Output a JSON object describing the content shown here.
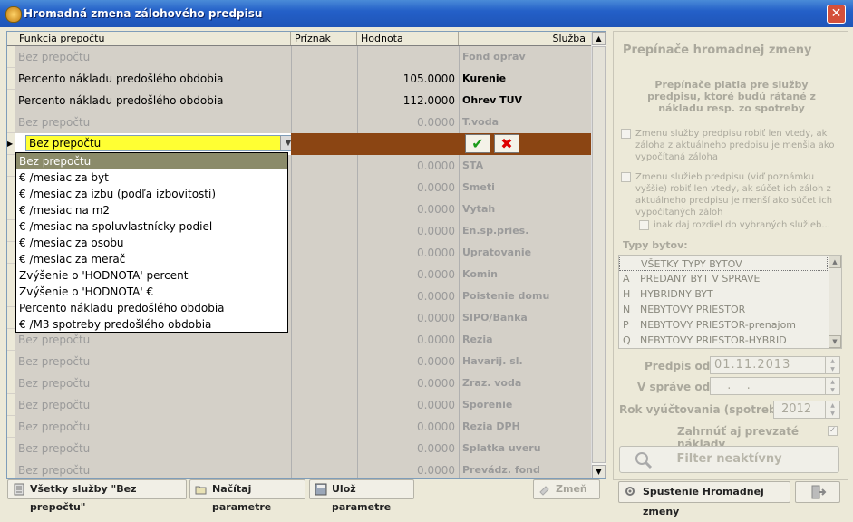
{
  "window": {
    "title": "Hromadná zmena zálohového predpisu",
    "close_glyph": "✕"
  },
  "grid": {
    "headers": [
      "Funkcia prepočtu",
      "Príznak",
      "Hodnota",
      "Služba"
    ],
    "rows": [
      {
        "func": "Bez prepočtu",
        "value": "",
        "service": "Fond oprav",
        "state": "inactive"
      },
      {
        "func": "Percento nákladu predošlého obdobia",
        "value": "105.0000",
        "service": "Kurenie",
        "state": "active"
      },
      {
        "func": "Percento nákladu predošlého obdobia",
        "value": "112.0000",
        "service": "Ohrev TUV",
        "state": "active"
      },
      {
        "func": "Bez prepočtu",
        "value": "0.0000",
        "service": "T.voda",
        "state": "inactive"
      },
      {
        "func": "Bez prepočtu",
        "value": "",
        "service": "",
        "state": "edit"
      },
      {
        "func": "",
        "value": "0.0000",
        "service": "STA",
        "state": "inactive"
      },
      {
        "func": "",
        "value": "0.0000",
        "service": "Smeti",
        "state": "inactive"
      },
      {
        "func": "",
        "value": "0.0000",
        "service": "Vytah",
        "state": "inactive"
      },
      {
        "func": "",
        "value": "0.0000",
        "service": "En.sp.pries.",
        "state": "inactive"
      },
      {
        "func": "",
        "value": "0.0000",
        "service": "Upratovanie",
        "state": "inactive"
      },
      {
        "func": "",
        "value": "0.0000",
        "service": "Komin",
        "state": "inactive"
      },
      {
        "func": "",
        "value": "0.0000",
        "service": "Poistenie domu",
        "state": "inactive"
      },
      {
        "func": "",
        "value": "0.0000",
        "service": "SIPO/Banka",
        "state": "inactive"
      },
      {
        "func": "Bez prepočtu",
        "value": "0.0000",
        "service": "Rezia",
        "state": "inactive"
      },
      {
        "func": "Bez prepočtu",
        "value": "0.0000",
        "service": "Havarij. sl.",
        "state": "inactive"
      },
      {
        "func": "Bez prepočtu",
        "value": "0.0000",
        "service": "Zraz. voda",
        "state": "inactive"
      },
      {
        "func": "Bez prepočtu",
        "value": "0.0000",
        "service": "Sporenie",
        "state": "inactive"
      },
      {
        "func": "Bez prepočtu",
        "value": "0.0000",
        "service": "Rezia DPH",
        "state": "inactive"
      },
      {
        "func": "Bez prepočtu",
        "value": "0.0000",
        "service": "Splatka uveru",
        "state": "inactive"
      },
      {
        "func": "Bez prepočtu",
        "value": "0.0000",
        "service": "Prevádz. fond",
        "state": "inactive"
      }
    ]
  },
  "dropdown": {
    "selected": "Bez prepočtu",
    "options": [
      "Bez prepočtu",
      "€ /mesiac za byt",
      "€ /mesiac za izbu (podľa izbovitosti)",
      "€ /mesiac na m2",
      "€ /mesiac na spoluvlastnícky podiel",
      "€ /mesiac za osobu",
      "€ /mesiac za merač",
      "Zvýšenie o 'HODNOTA' percent",
      "Zvýšenie o 'HODNOTA' €",
      "Percento nákladu predošlého obdobia",
      "€ /M3  spotreby predošlého obdobia"
    ]
  },
  "buttons": {
    "all_none": "Všetky služby \"Bez prepočtu\"",
    "load": "Načítaj parametre",
    "save": "Ulož parametre",
    "change": "Zmeň"
  },
  "right": {
    "title": "Prepínače hromadnej zmeny",
    "subtitle": "Prepínače platia pre služby predpisu, ktoré budú rátané z nákladu resp. zo spotreby",
    "cb1": "Zmenu služby predpisu robiť len vtedy, ak záloha z aktuálneho predpisu  je menšia  ako vypočítaná záloha",
    "cb2": "Zmenu služieb predpisu (viď poznámku vyššie) robiť len vtedy, ak súčet ich záloh z aktuálneho predpisu  je menší  ako súčet ich vypočítaných záloh",
    "cb3": "inak daj rozdiel do vybraných služieb...",
    "types_label": "Typy bytov:",
    "types": [
      {
        "k": "",
        "v": "VŠETKY TYPY BYTOV"
      },
      {
        "k": "A",
        "v": "PREDANY BYT V SPRAVE"
      },
      {
        "k": "H",
        "v": "HYBRIDNY BYT"
      },
      {
        "k": "N",
        "v": "NEBYTOVY PRIESTOR"
      },
      {
        "k": "P",
        "v": "NEBYTOVY PRIESTOR-prenajom"
      },
      {
        "k": "Q",
        "v": "NEBYTOVY PRIESTOR-HYBRID"
      }
    ],
    "predpis_label": "Predpis od:",
    "predpis_value": "01.11.2013",
    "sprave_label": "V správe od:",
    "sprave_value": "  .  .",
    "rok_label": "Rok vyúčtovania (spotreby):",
    "rok_value": "2012",
    "zahrnut_label": "Zahrnúť aj prevzaté náklady",
    "filter_label": "Filter neaktívny",
    "spustenie_label": "Spustenie Hromadnej zmeny"
  }
}
